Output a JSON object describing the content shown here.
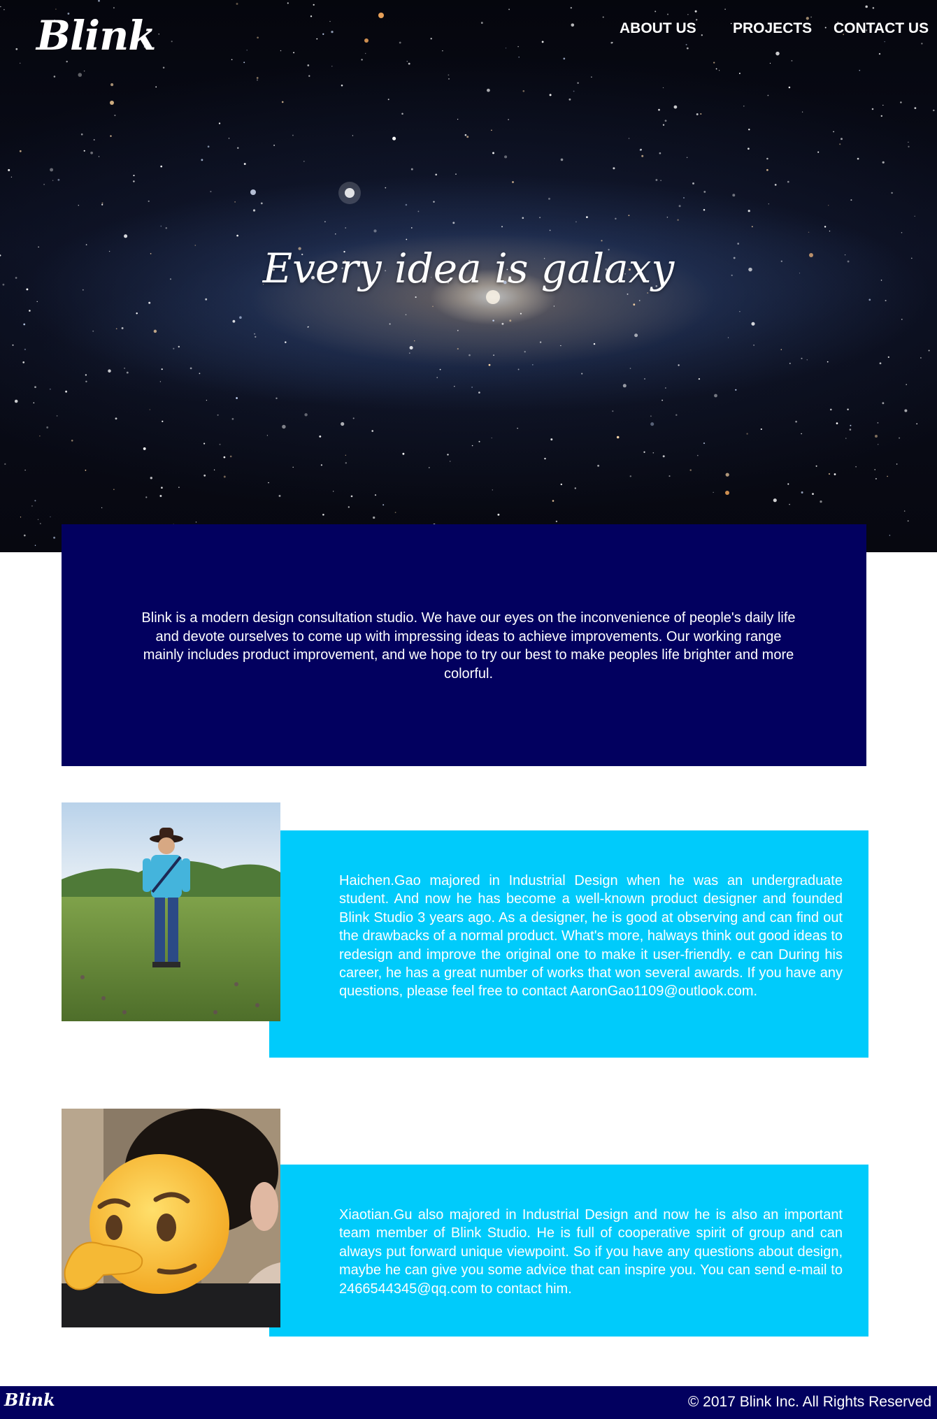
{
  "brand": {
    "logo": "Blink"
  },
  "nav": {
    "items": [
      {
        "label": "ABOUT US"
      },
      {
        "label": "PROJECTS"
      },
      {
        "label": "CONTACT US"
      }
    ]
  },
  "hero": {
    "title": "Every idea is galaxy"
  },
  "about": {
    "text": "Blink is a modern design consultation studio. We have our eyes on the inconvenience of people's daily life and devote ourselves to come up with impressing ideas to achieve improvements. Our working range mainly includes product improvement, and we hope to try our best to make peoples life brighter and more colorful."
  },
  "members": [
    {
      "photo_icon": "person-photo",
      "bio": "Haichen.Gao majored in Industrial Design when he was an undergraduate student. And now he has become a well-known product designer and founded Blink Studio 3 years ago. As a designer, he is good at observing and can find out the drawbacks of a normal product. What's more, halways think out good ideas to redesign and improve the original one to make it user-friendly. e can During his career, he has a great number of works that won several awards. If you have any questions, please feel free to contact AaronGao1109@outlook.com."
    },
    {
      "photo_icon": "thinking-face-emoji",
      "bio": "Xiaotian.Gu also majored in Industrial Design and now he is also an important team member of Blink Studio. He is full of cooperative spirit of group and can always put forward unique viewpoint. So if you have any questions about design, maybe he can give you some advice that can inspire you. You can send e-mail to 2466544345@qq.com to contact him."
    }
  ],
  "footer": {
    "logo": "Blink",
    "copyright": "© 2017 Blink Inc. All Rights Reserved"
  },
  "colors": {
    "navy": "#02005f",
    "cyan": "#00cbfb",
    "white": "#ffffff"
  }
}
